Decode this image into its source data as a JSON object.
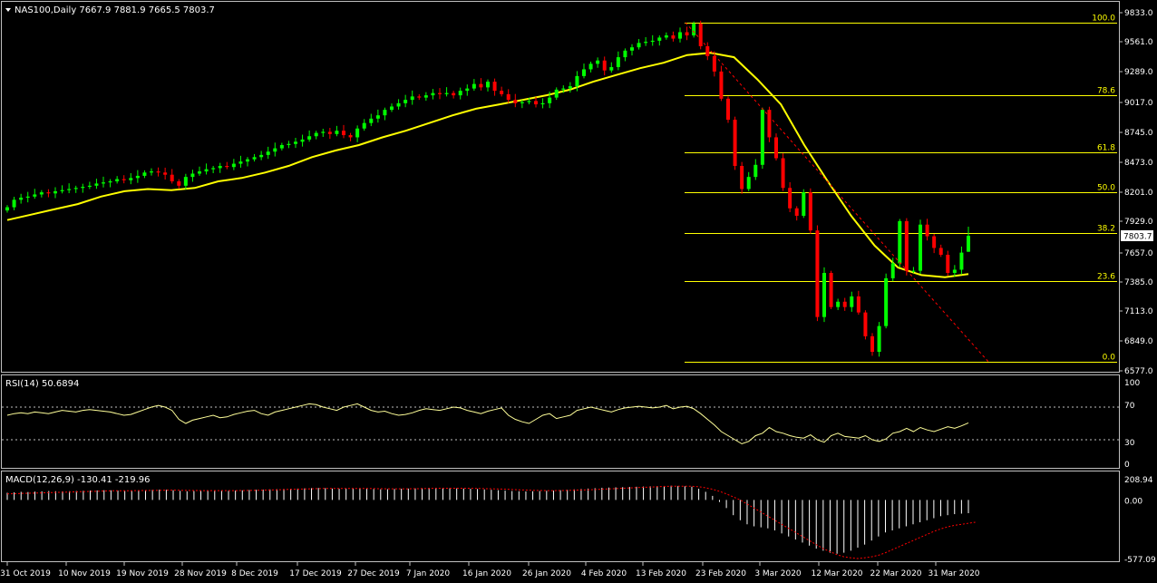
{
  "main": {
    "header": "NAS100,Daily  7667.9 7881.9 7665.5 7803.7",
    "price_label": "7803.7",
    "y_ticks": [
      "9833.0",
      "9561.0",
      "9289.0",
      "9017.0",
      "8745.0",
      "8473.0",
      "8201.0",
      "7929.0",
      "7657.0",
      "7385.0",
      "7113.0",
      "6849.0",
      "6577.0"
    ],
    "fib_labels": [
      "100.0",
      "78.6",
      "61.8",
      "50.0",
      "38.2",
      "23.6",
      "0.0"
    ]
  },
  "rsi": {
    "header": "RSI(14) 50.6894",
    "ticks": [
      "100",
      "70",
      "30",
      "0"
    ]
  },
  "macd": {
    "header": "MACD(12,26,9) -130.41 -219.96",
    "ticks": [
      "208.94",
      "0.00",
      "-577.09"
    ]
  },
  "x_ticks": [
    "31 Oct 2019",
    "10 Nov 2019",
    "19 Nov 2019",
    "28 Nov 2019",
    "8 Dec 2019",
    "17 Dec 2019",
    "27 Dec 2019",
    "7 Jan 2020",
    "16 Jan 2020",
    "26 Jan 2020",
    "4 Feb 2020",
    "13 Feb 2020",
    "23 Feb 2020",
    "3 Mar 2020",
    "12 Mar 2020",
    "22 Mar 2020",
    "31 Mar 2020"
  ],
  "colors": {
    "background": "#000000",
    "bull": "#00ff00",
    "bear": "#ff0000",
    "ma": "#ffff00",
    "fib": "#ffff00",
    "rsi": "#ffff99",
    "macd_hist": "#ffffff",
    "macd_signal": "#ff0000",
    "frame": "#c0c0c0",
    "text": "#ffffff",
    "label_bg": "#ffffff",
    "label_text": "#000000"
  },
  "chart_data": {
    "type": "candlestick",
    "symbol": "NAS100",
    "timeframe": "Daily",
    "ohlc_last": {
      "open": 7667.9,
      "high": 7881.9,
      "low": 7665.5,
      "close": 7803.7
    },
    "close_approx": [
      8060,
      8130,
      8150,
      8160,
      8180,
      8200,
      8190,
      8210,
      8220,
      8230,
      8240,
      8250,
      8260,
      8280,
      8290,
      8300,
      8320,
      8310,
      8330,
      8350,
      8380,
      8390,
      8380,
      8360,
      8300,
      8260,
      8340,
      8370,
      8390,
      8410,
      8420,
      8440,
      8430,
      8460,
      8480,
      8500,
      8520,
      8540,
      8570,
      8600,
      8630,
      8640,
      8660,
      8680,
      8710,
      8740,
      8750,
      8730,
      8760,
      8720,
      8700,
      8780,
      8830,
      8870,
      8900,
      8950,
      8980,
      9010,
      9040,
      9070,
      9060,
      9080,
      9100,
      9090,
      9100,
      9080,
      9120,
      9140,
      9180,
      9150,
      9200,
      9120,
      9090,
      9040,
      9010,
      9020,
      9030,
      9000,
      9010,
      9060,
      9130,
      9140,
      9160,
      9250,
      9310,
      9360,
      9390,
      9300,
      9330,
      9420,
      9480,
      9510,
      9550,
      9560,
      9570,
      9600,
      9620,
      9590,
      9650,
      9620,
      9730,
      9520,
      9430,
      9290,
      9050,
      8860,
      8440,
      8230,
      8340,
      8450,
      8950,
      8700,
      8510,
      8240,
      8050,
      7980,
      8200,
      7850,
      7060,
      7470,
      7150,
      7200,
      7150,
      7250,
      7100,
      6890,
      6750,
      6980,
      7420,
      7560,
      7930,
      7490,
      7490,
      7900,
      7800,
      7700,
      7640,
      7470,
      7500,
      7660,
      7803.7
    ],
    "ma": {
      "name": "",
      "approx": [
        7940,
        7990,
        8040,
        8090,
        8160,
        8210,
        8230,
        8220,
        8240,
        8300,
        8330,
        8380,
        8440,
        8520,
        8580,
        8630,
        8700,
        8760,
        8830,
        8900,
        8960,
        9000,
        9040,
        9080,
        9130,
        9200,
        9260,
        9320,
        9370,
        9440,
        9460,
        9420,
        9220,
        9000,
        8630,
        8300,
        7980,
        7720,
        7520,
        7450,
        7430,
        7460
      ]
    },
    "fibonacci": [
      {
        "level": "100.0",
        "price": 9740
      },
      {
        "level": "78.6",
        "price": 9080
      },
      {
        "level": "61.8",
        "price": 8560
      },
      {
        "level": "50.0",
        "price": 8200
      },
      {
        "level": "38.2",
        "price": 7830
      },
      {
        "level": "23.6",
        "price": 7390
      },
      {
        "level": "0.0",
        "price": 6660
      }
    ],
    "trendline": {
      "from": {
        "date": "13 Feb 2020",
        "price": 9740
      },
      "to": {
        "date": "2 Apr 2020",
        "price": 6660
      },
      "style": "dashed"
    },
    "ylim": [
      6577.0,
      9900
    ],
    "rsi": {
      "period": 14,
      "value": 50.6894,
      "levels": [
        70,
        30
      ],
      "ylim": [
        0,
        100
      ],
      "values": [
        60,
        62,
        63,
        62,
        64,
        63,
        62,
        64,
        66,
        65,
        64,
        66,
        67,
        66,
        65,
        64,
        62,
        60,
        61,
        64,
        67,
        70,
        72,
        70,
        66,
        55,
        50,
        54,
        56,
        58,
        60,
        57,
        58,
        61,
        63,
        65,
        66,
        62,
        60,
        64,
        66,
        68,
        70,
        72,
        74,
        73,
        70,
        68,
        66,
        70,
        72,
        74,
        70,
        66,
        64,
        65,
        62,
        60,
        61,
        63,
        66,
        68,
        67,
        66,
        68,
        70,
        69,
        66,
        64,
        62,
        65,
        67,
        69,
        60,
        55,
        52,
        50,
        55,
        60,
        62,
        56,
        58,
        60,
        66,
        68,
        70,
        68,
        66,
        64,
        67,
        69,
        70,
        71,
        70,
        69,
        70,
        72,
        68,
        70,
        71,
        68,
        62,
        55,
        48,
        40,
        35,
        30,
        25,
        28,
        35,
        38,
        45,
        40,
        38,
        35,
        33,
        32,
        36,
        30,
        27,
        35,
        38,
        34,
        33,
        32,
        35,
        30,
        28,
        31,
        38,
        40,
        44,
        40,
        45,
        42,
        40,
        43,
        46,
        44,
        47,
        50.6894
      ]
    },
    "macd": {
      "fast": 12,
      "slow": 26,
      "signal": [
        60,
        62,
        64,
        66,
        68,
        70,
        72,
        74,
        76,
        78,
        80,
        82,
        84,
        86,
        88,
        90,
        90,
        90,
        91,
        92,
        93,
        94,
        95,
        96,
        96,
        95,
        94,
        93,
        92,
        92,
        92,
        92,
        92,
        92,
        93,
        94,
        95,
        96,
        98,
        100,
        102,
        104,
        106,
        108,
        110,
        112,
        113,
        113,
        113,
        113,
        113,
        113,
        113,
        112,
        111,
        110,
        110,
        110,
        110,
        111,
        112,
        113,
        114,
        115,
        115,
        115,
        115,
        114,
        113,
        112,
        110,
        108,
        106,
        103,
        100,
        97,
        95,
        93,
        92,
        92,
        93,
        94,
        96,
        98,
        100,
        103,
        106,
        109,
        112,
        115,
        118,
        121,
        124,
        127,
        130,
        133,
        135,
        136,
        136,
        135,
        130,
        120,
        105,
        85,
        60,
        30,
        0,
        -40,
        -80,
        -120,
        -160,
        -200,
        -240,
        -280,
        -320,
        -360,
        -400,
        -440,
        -480,
        -510,
        -540,
        -560,
        -570,
        -577,
        -570,
        -560,
        -545,
        -520,
        -490,
        -460,
        -430,
        -400,
        -370,
        -340,
        -310,
        -285,
        -265,
        -250,
        -240,
        -230,
        -219.96
      ],
      "main": -130.41,
      "signal_value": -219.96,
      "ylim": [
        -577.09,
        208.94
      ],
      "hist": [
        70,
        75,
        80,
        78,
        82,
        85,
        88,
        86,
        84,
        86,
        88,
        90,
        92,
        94,
        96,
        95,
        93,
        90,
        92,
        95,
        98,
        100,
        102,
        100,
        96,
        90,
        86,
        88,
        90,
        92,
        94,
        92,
        90,
        92,
        95,
        98,
        100,
        102,
        104,
        106,
        108,
        110,
        112,
        114,
        116,
        118,
        116,
        112,
        110,
        112,
        114,
        116,
        112,
        108,
        105,
        106,
        108,
        110,
        112,
        114,
        116,
        118,
        120,
        118,
        116,
        114,
        112,
        110,
        108,
        104,
        100,
        96,
        92,
        88,
        86,
        84,
        86,
        88,
        90,
        92,
        96,
        100,
        104,
        108,
        112,
        116,
        120,
        122,
        124,
        126,
        128,
        130,
        132,
        134,
        136,
        138,
        140,
        138,
        135,
        130,
        110,
        80,
        40,
        -20,
        -80,
        -150,
        -200,
        -240,
        -260,
        -270,
        -280,
        -300,
        -330,
        -360,
        -390,
        -420,
        -450,
        -480,
        -500,
        -520,
        -530,
        -520,
        -500,
        -470,
        -440,
        -400,
        -360,
        -320,
        -300,
        -280,
        -260,
        -240,
        -220,
        -200,
        -180,
        -160,
        -150,
        -140,
        -135,
        -130.41
      ]
    }
  }
}
